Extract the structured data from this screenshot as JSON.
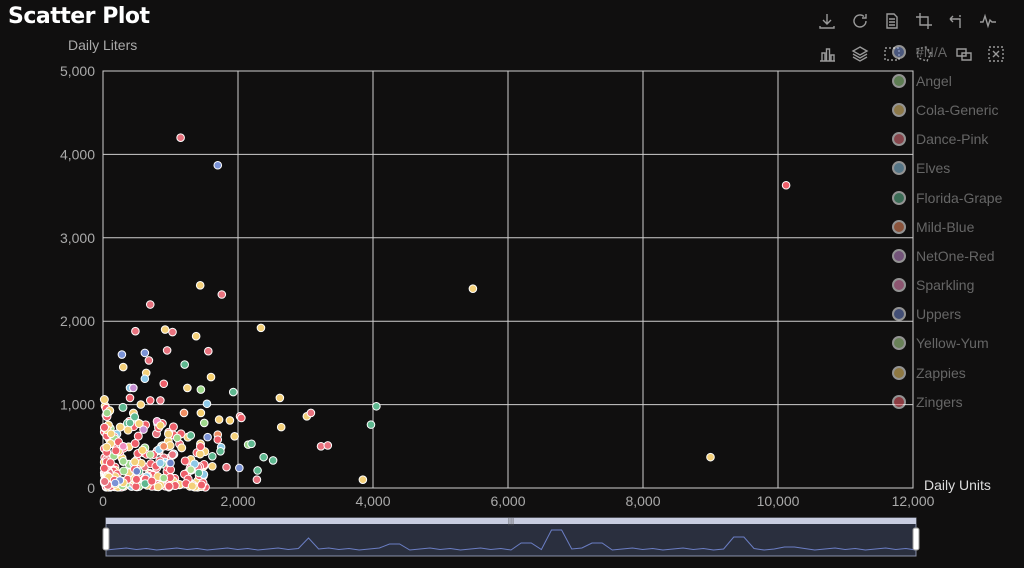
{
  "title": "Scatter Plot",
  "toolbox": {
    "icons": [
      "download-icon",
      "refresh-icon",
      "data-view-icon",
      "zoom-icon",
      "zoom-reset-icon",
      "line-chart-icon",
      "bar-chart-icon",
      "stack-icon",
      "rect-select-icon",
      "polygon-select-icon",
      "keep-select-icon",
      "clear-select-icon"
    ]
  },
  "chart_data": {
    "type": "scatter",
    "title": "Scatter Plot",
    "xlabel": "Daily Units",
    "ylabel": "Daily Liters",
    "xlim": [
      0,
      12000
    ],
    "ylim": [
      0,
      5000
    ],
    "x_ticks": [
      "0",
      "2,000",
      "4,000",
      "6,000",
      "8,000",
      "10,000",
      "12,000"
    ],
    "y_ticks": [
      "0",
      "1,000",
      "2,000",
      "3,000",
      "4,000",
      "5,000"
    ],
    "grid": true,
    "legend_position": "right",
    "series": [
      {
        "name": "#N/A",
        "color": "#7b93d6",
        "points": [
          [
            1700,
            3870
          ],
          [
            280,
            1600
          ],
          [
            620,
            1620
          ],
          [
            2020,
            240
          ],
          [
            1550,
            610
          ],
          [
            250,
            90
          ],
          [
            180,
            60
          ]
        ]
      },
      {
        "name": "Angel",
        "color": "#9ed88c",
        "points": [
          [
            60,
            900
          ],
          [
            1500,
            780
          ],
          [
            2150,
            520
          ],
          [
            1450,
            1180
          ],
          [
            300,
            320
          ],
          [
            900,
            120
          ],
          [
            1100,
            600
          ]
        ]
      },
      {
        "name": "Cola-Generic",
        "color": "#f4d07a",
        "points": [
          [
            5480,
            2390
          ],
          [
            1440,
            2430
          ],
          [
            2340,
            1920
          ],
          [
            1380,
            1820
          ],
          [
            2620,
            1080
          ],
          [
            9000,
            370
          ],
          [
            3850,
            100
          ],
          [
            920,
            1900
          ],
          [
            640,
            1380
          ],
          [
            1950,
            620
          ],
          [
            1620,
            260
          ],
          [
            3020,
            860
          ],
          [
            2640,
            730
          ],
          [
            300,
            1450
          ],
          [
            1250,
            1200
          ],
          [
            1720,
            820
          ],
          [
            560,
            1000
          ],
          [
            120,
            650
          ]
        ]
      },
      {
        "name": "Dance-Pink",
        "color": "#e8737f",
        "points": [
          [
            1150,
            4200
          ],
          [
            1760,
            2320
          ],
          [
            700,
            2200
          ],
          [
            480,
            1880
          ],
          [
            1030,
            1870
          ],
          [
            680,
            1530
          ],
          [
            950,
            1650
          ],
          [
            1560,
            1640
          ],
          [
            2030,
            860
          ],
          [
            3080,
            900
          ],
          [
            3230,
            500
          ],
          [
            3330,
            510
          ],
          [
            1830,
            250
          ],
          [
            2280,
            100
          ],
          [
            850,
            1050
          ],
          [
            1030,
            400
          ]
        ]
      },
      {
        "name": "Elves",
        "color": "#8ec9e8",
        "points": [
          [
            620,
            1310
          ],
          [
            1540,
            1010
          ],
          [
            400,
            1200
          ],
          [
            1750,
            490
          ],
          [
            850,
            300
          ]
        ]
      },
      {
        "name": "Florida-Grape",
        "color": "#5fb890",
        "points": [
          [
            1210,
            1480
          ],
          [
            4050,
            980
          ],
          [
            3970,
            760
          ],
          [
            1930,
            1150
          ],
          [
            2200,
            530
          ],
          [
            2380,
            370
          ],
          [
            2520,
            330
          ],
          [
            1620,
            380
          ],
          [
            1740,
            440
          ],
          [
            1420,
            180
          ],
          [
            1300,
            630
          ],
          [
            2290,
            210
          ],
          [
            400,
            780
          ]
        ]
      },
      {
        "name": "Mild-Blue",
        "color": "#f08e62",
        "points": [
          [
            1700,
            640
          ],
          [
            1200,
            900
          ],
          [
            900,
            500
          ]
        ]
      },
      {
        "name": "NetOne-Red",
        "color": "#c58ed1",
        "points": [
          [
            450,
            1200
          ],
          [
            600,
            700
          ]
        ]
      },
      {
        "name": "Sparkling",
        "color": "#f28fc0",
        "points": [
          [
            800,
            800
          ],
          [
            300,
            500
          ]
        ]
      },
      {
        "name": "Uppers",
        "color": "#6c83c9",
        "points": [
          [
            500,
            200
          ],
          [
            1000,
            300
          ]
        ]
      },
      {
        "name": "Yellow-Yum",
        "color": "#b3df94",
        "points": [
          [
            700,
            400
          ],
          [
            1300,
            220
          ]
        ]
      },
      {
        "name": "Zappies",
        "color": "#f6cf6d",
        "points": [
          [
            1880,
            810
          ],
          [
            850,
            750
          ],
          [
            1600,
            1330
          ],
          [
            1450,
            900
          ]
        ]
      },
      {
        "name": "Zingers",
        "color": "#ee5f6a",
        "points": [
          [
            10120,
            3630
          ],
          [
            2050,
            840
          ],
          [
            1700,
            580
          ],
          [
            400,
            1080
          ],
          [
            700,
            1050
          ],
          [
            900,
            1250
          ]
        ]
      }
    ]
  },
  "legend_label_color": "#666666",
  "datazoom": {
    "start": 0,
    "end": 100
  }
}
